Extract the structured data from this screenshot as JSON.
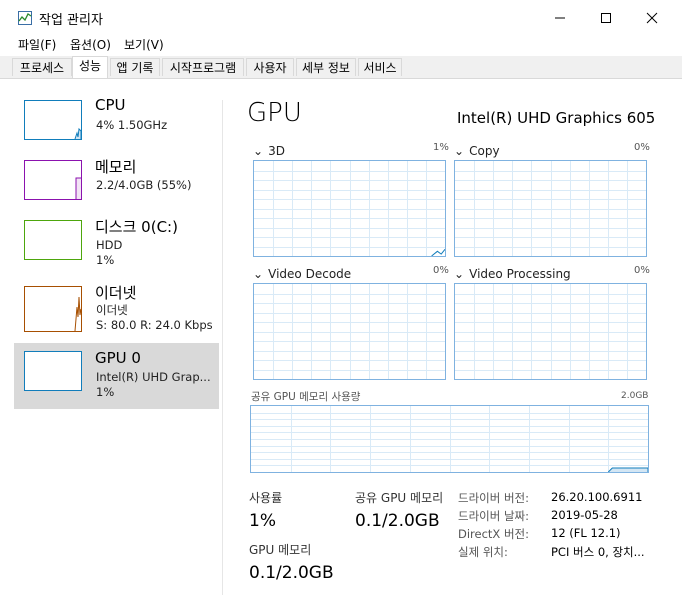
{
  "window": {
    "title": "작업 관리자",
    "buttons": {
      "minimize": "—",
      "maximize": "☐",
      "close": "✕"
    }
  },
  "menu": [
    "파일(F)",
    "옵션(O)",
    "보기(V)"
  ],
  "tabs": [
    "프로세스",
    "성능",
    "앱 기록",
    "시작프로그램",
    "사용자",
    "세부 정보",
    "서비스"
  ],
  "active_tab": "성능",
  "sidebar": {
    "items": [
      {
        "name": "CPU",
        "lines": [
          "4%  1.50GHz"
        ],
        "color": "#117dbb"
      },
      {
        "name": "메모리",
        "lines": [
          "2.2/4.0GB (55%)"
        ],
        "color": "#8b12ae"
      },
      {
        "name": "디스크 0(C:)",
        "lines": [
          "HDD",
          "1%"
        ],
        "color": "#4da60c"
      },
      {
        "name": "이더넷",
        "lines": [
          "이더넷",
          "S: 80.0  R: 24.0 Kbps"
        ],
        "color": "#a74f01"
      },
      {
        "name": "GPU 0",
        "lines": [
          "Intel(R) UHD Grap...",
          "1%"
        ],
        "color": "#117dbb",
        "selected": true
      }
    ]
  },
  "main": {
    "title": "GPU",
    "model": "Intel(R) UHD Graphics 605",
    "engines": [
      {
        "label": "3D",
        "percent": "1%"
      },
      {
        "label": "Copy",
        "percent": "0%"
      },
      {
        "label": "Video Decode",
        "percent": "0%"
      },
      {
        "label": "Video Processing",
        "percent": "0%"
      }
    ],
    "shared_memory": {
      "label": "공유 GPU 메모리 사용량",
      "max": "2.0GB"
    },
    "stats": {
      "usage_label": "사용률",
      "usage_value": "1%",
      "shared_label": "공유 GPU 메모리",
      "shared_value": "0.1/2.0GB",
      "gpu_mem_label": "GPU 메모리",
      "gpu_mem_value": "0.1/2.0GB"
    },
    "info": [
      {
        "label": "드라이버 버전:",
        "value": "26.20.100.6911"
      },
      {
        "label": "드라이버 날짜:",
        "value": "2019-05-28"
      },
      {
        "label": "DirectX 버전:",
        "value": "12 (FL 12.1)"
      },
      {
        "label": "실제 위치:",
        "value": "PCI 버스 0, 장치..."
      }
    ]
  },
  "colors": {
    "gpu_graph": "#117dbb",
    "selected_bg": "#d9d9d9"
  }
}
